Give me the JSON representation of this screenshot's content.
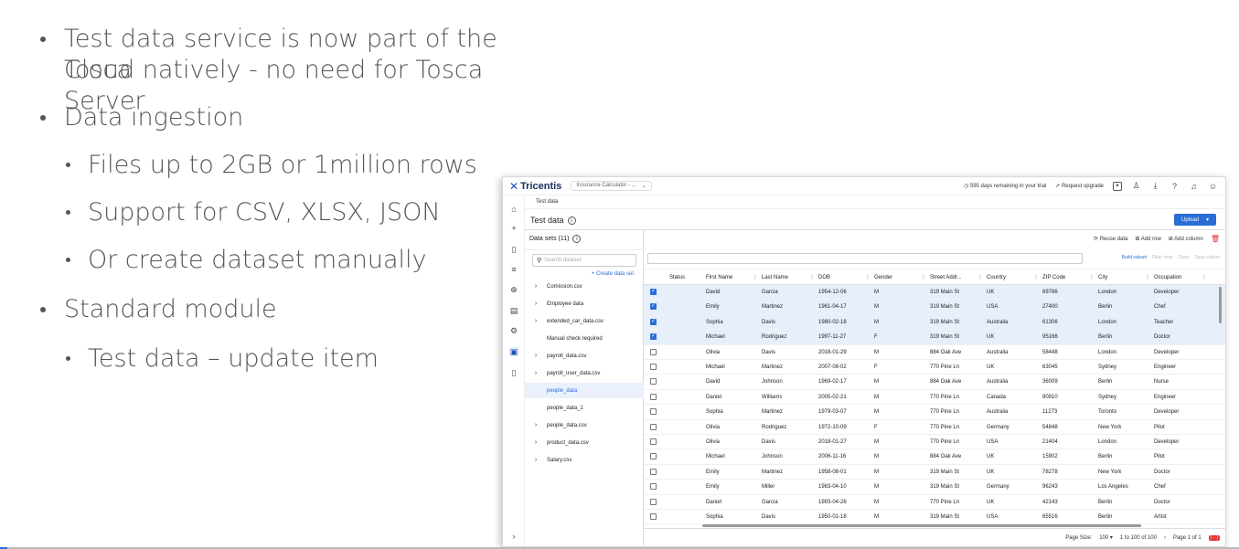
{
  "slide": {
    "bullets": [
      {
        "line1": "Test data service is now part of the Tosca",
        "line2": "Cloud natively - no need for Tosca Server"
      },
      {
        "line1": "Data ingestion"
      },
      {
        "line1": "Files up to 2GB or 1million rows"
      },
      {
        "line1": "Support for CSV, XLSX, JSON"
      },
      {
        "line1": "Or create dataset manually"
      },
      {
        "line1": "Standard module"
      },
      {
        "line1": "Test data – update item"
      }
    ]
  },
  "app": {
    "logo": "Tricentis",
    "project": "Insurance Calculator - ...",
    "trial": "595 days remaining in your trial",
    "upgrade": "Request upgrade",
    "breadcrumb": "Test data",
    "title": "Test data",
    "upload": "Upload",
    "datasets_title": "Data sets (11)",
    "search_placeholder": "Search dataset",
    "create": "+ Create data set",
    "datasets": [
      {
        "name": "Comission.csv",
        "expandable": true
      },
      {
        "name": "Employee data",
        "expandable": true
      },
      {
        "name": "extended_car_data.csv",
        "expandable": true
      },
      {
        "name": "Manual check required",
        "expandable": false
      },
      {
        "name": "payroll_data.csv",
        "expandable": true
      },
      {
        "name": "payroll_user_data.csv",
        "expandable": true
      },
      {
        "name": "people_data",
        "expandable": false,
        "selected": true
      },
      {
        "name": "people_data_1",
        "expandable": false
      },
      {
        "name": "people_data.csv",
        "expandable": true
      },
      {
        "name": "product_data.csv",
        "expandable": true
      },
      {
        "name": "Salary.csv",
        "expandable": true
      }
    ],
    "actions": {
      "reuse": "Reuse data",
      "add_row": "Add row",
      "add_col": "Add column"
    },
    "subactions": {
      "build": "Build subset",
      "filter": "Filter view",
      "clear": "Clear",
      "save": "Save subset"
    },
    "columns": [
      "Status",
      "First Name",
      "Last Name",
      "DOB",
      "Gender",
      "Street Addr...",
      "Country",
      "ZIP Code",
      "City",
      "Occupation"
    ],
    "rows": [
      {
        "checked": true,
        "v": [
          "David",
          "Garcia",
          "1954-12-06",
          "M",
          "319 Main St",
          "UK",
          "69786",
          "London",
          "Developer"
        ]
      },
      {
        "checked": true,
        "v": [
          "Emily",
          "Martinez",
          "1961-04-17",
          "M",
          "319 Main St",
          "USA",
          "27400",
          "Berlin",
          "Chef"
        ]
      },
      {
        "checked": true,
        "v": [
          "Sophia",
          "Davis",
          "1980-02-18",
          "M",
          "319 Main St",
          "Australia",
          "61306",
          "London",
          "Teacher"
        ]
      },
      {
        "checked": true,
        "v": [
          "Michael",
          "Rodriguez",
          "1997-11-27",
          "F",
          "319 Main St",
          "UK",
          "95166",
          "Berlin",
          "Doctor"
        ]
      },
      {
        "checked": false,
        "v": [
          "Olivia",
          "Davis",
          "2018-01-29",
          "M",
          "884 Oak Ave",
          "Australia",
          "58448",
          "London",
          "Developer"
        ]
      },
      {
        "checked": false,
        "v": [
          "Michael",
          "Martinez",
          "2007-08-02",
          "F",
          "770 Pine Ln",
          "UK",
          "63045",
          "Sydney",
          "Engineer"
        ]
      },
      {
        "checked": false,
        "v": [
          "David",
          "Johnson",
          "1969-02-17",
          "M",
          "884 Oak Ave",
          "Australia",
          "36009",
          "Berlin",
          "Nurse"
        ]
      },
      {
        "checked": false,
        "v": [
          "Daniel",
          "Williams",
          "2005-02-21",
          "M",
          "770 Pine Ln",
          "Canada",
          "90910",
          "Sydney",
          "Engineer"
        ]
      },
      {
        "checked": false,
        "v": [
          "Sophia",
          "Martinez",
          "1979-03-07",
          "M",
          "770 Pine Ln",
          "Australia",
          "11273",
          "Toronto",
          "Developer"
        ]
      },
      {
        "checked": false,
        "v": [
          "Olivia",
          "Rodriguez",
          "1972-10-09",
          "F",
          "770 Pine Ln",
          "Germany",
          "54848",
          "New York",
          "Pilot"
        ]
      },
      {
        "checked": false,
        "v": [
          "Olivia",
          "Davis",
          "2018-01-27",
          "M",
          "770 Pine Ln",
          "USA",
          "21404",
          "London",
          "Developer"
        ]
      },
      {
        "checked": false,
        "v": [
          "Michael",
          "Johnson",
          "2006-11-16",
          "M",
          "884 Oak Ave",
          "UK",
          "15902",
          "Berlin",
          "Pilot"
        ]
      },
      {
        "checked": false,
        "v": [
          "Emily",
          "Martinez",
          "1958-08-01",
          "M",
          "319 Main St",
          "UK",
          "78278",
          "New York",
          "Doctor"
        ]
      },
      {
        "checked": false,
        "v": [
          "Emily",
          "Miller",
          "1983-04-10",
          "M",
          "319 Main St",
          "Germany",
          "96243",
          "Los Angeles",
          "Chef"
        ]
      },
      {
        "checked": false,
        "v": [
          "Daniel",
          "Garcia",
          "1993-04-26",
          "M",
          "770 Pine Ln",
          "UK",
          "42143",
          "Berlin",
          "Doctor"
        ]
      },
      {
        "checked": false,
        "v": [
          "Sophia",
          "Davis",
          "1950-01-18",
          "M",
          "319 Main St",
          "USA",
          "65516",
          "Berlin",
          "Artist"
        ]
      }
    ],
    "footer": {
      "page_size_label": "Page Size:",
      "page_size": "100",
      "range": "1 to 100 of 100",
      "page": "Page 1 of 1"
    }
  }
}
